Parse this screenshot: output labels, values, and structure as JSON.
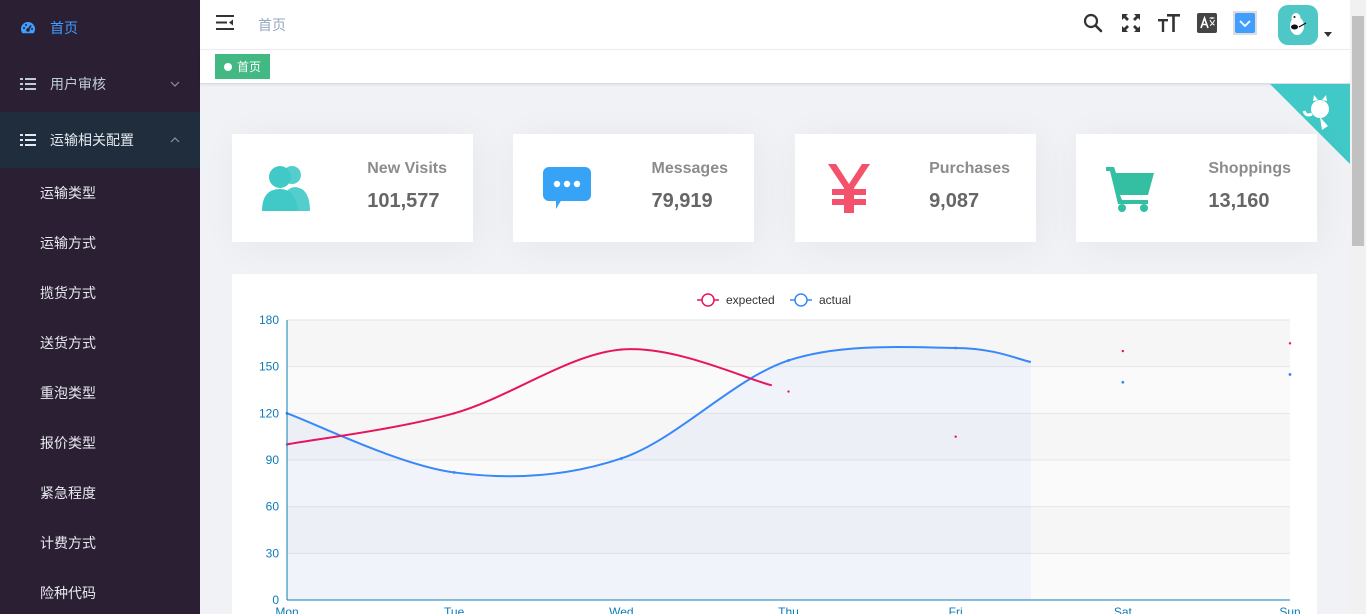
{
  "sidebar": {
    "items": [
      {
        "label": "首页",
        "icon": "dashboard-icon",
        "state": "active"
      },
      {
        "label": "用户审核",
        "icon": "list-icon",
        "state": "collapsed"
      },
      {
        "label": "运输相关配置",
        "icon": "list-icon",
        "state": "open"
      }
    ],
    "sub_items": [
      "运输类型",
      "运输方式",
      "揽货方式",
      "送货方式",
      "重泡类型",
      "报价类型",
      "紧急程度",
      "计费方式",
      "险种代码"
    ]
  },
  "navbar": {
    "breadcrumb": "首页",
    "icons": [
      "search-icon",
      "fullscreen-icon",
      "font-size-icon",
      "translate-icon",
      "theme-select-icon"
    ]
  },
  "tags": {
    "active": "首页"
  },
  "cards": [
    {
      "label": "New Visits",
      "value": "101,577",
      "icon": "peoples-icon",
      "color": "#40c9c6"
    },
    {
      "label": "Messages",
      "value": "79,919",
      "icon": "message-icon",
      "color": "#36a3f7"
    },
    {
      "label": "Purchases",
      "value": "9,087",
      "icon": "money-icon",
      "color": "#f4516c"
    },
    {
      "label": "Shoppings",
      "value": "13,160",
      "icon": "shopping-cart-icon",
      "color": "#34bfa3"
    }
  ],
  "colors": {
    "sidebar_bg": "#2b1f33",
    "accent": "#409eff",
    "tag_bg": "#42b983",
    "corner": "#40c9c6",
    "expected": "#e6155e",
    "actual": "#3888fa",
    "axis": "#0c7cb8"
  },
  "chart_data": {
    "type": "line",
    "categories": [
      "Mon",
      "Tue",
      "Wed",
      "Thu",
      "Fri",
      "Sat",
      "Sun"
    ],
    "series": [
      {
        "name": "expected",
        "values": [
          100,
          120,
          161,
          134,
          105,
          160,
          165
        ]
      },
      {
        "name": "actual",
        "values": [
          120,
          82,
          91,
          154,
          162,
          140,
          145
        ]
      }
    ],
    "yticks": [
      0,
      30,
      60,
      90,
      120,
      150,
      180
    ],
    "ylim": [
      0,
      180
    ],
    "legend": "top-center",
    "grid": true
  }
}
